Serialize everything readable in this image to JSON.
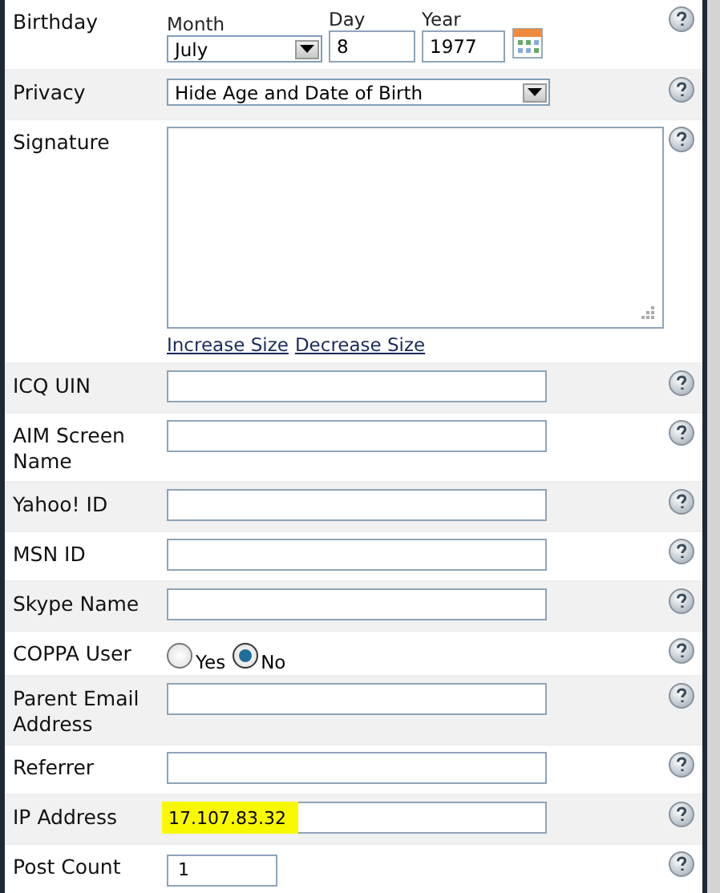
{
  "rows": [
    {
      "kind": "date",
      "label": "Birthday",
      "month": {
        "caption": "Month",
        "value": "July"
      },
      "day": {
        "caption": "Day",
        "value": "8"
      },
      "year": {
        "caption": "Year",
        "value": "1977"
      }
    },
    {
      "kind": "select",
      "label": "Privacy",
      "value": "Hide Age and Date of Birth"
    },
    {
      "kind": "textarea",
      "label": "Signature",
      "links": [
        "Increase Size",
        "Decrease Size"
      ]
    },
    {
      "kind": "text",
      "label": "ICQ UIN"
    },
    {
      "kind": "text",
      "label": "AIM Screen Name"
    },
    {
      "kind": "text",
      "label": "Yahoo! ID"
    },
    {
      "kind": "text",
      "label": "MSN ID"
    },
    {
      "kind": "text",
      "label": "Skype Name"
    },
    {
      "kind": "radio",
      "label": "COPPA User",
      "options": [
        {
          "label": "Yes",
          "selected": false
        },
        {
          "label": "No",
          "selected": true
        }
      ]
    },
    {
      "kind": "text",
      "label": "Parent Email Address"
    },
    {
      "kind": "text",
      "label": "Referrer"
    },
    {
      "kind": "text",
      "label": "IP Address",
      "value": "17.107.83.32",
      "highlighted": true
    },
    {
      "kind": "short",
      "label": "Post Count",
      "value": "1"
    }
  ]
}
